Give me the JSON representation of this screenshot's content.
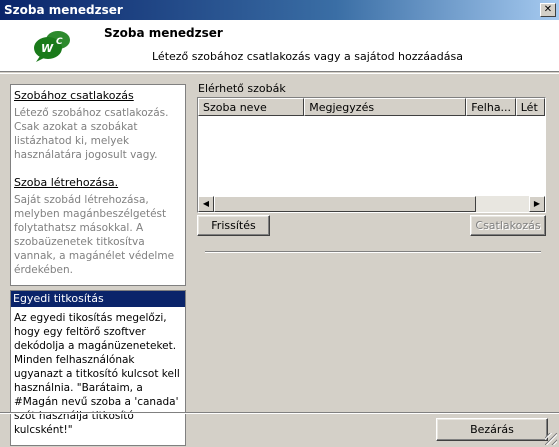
{
  "window": {
    "title": "Szoba menedzser"
  },
  "header": {
    "title": "Szoba menedzser",
    "subtitle": "Létező szobához csatlakozás vagy a sajátod hozzáadása"
  },
  "left": {
    "join_link": "Szobához csatlakozás",
    "join_text": "Létező szobához csatlakozás. Csak azokat a szobákat listázhatod ki, melyek használatára jogosult vagy.",
    "create_link": "Szoba létrehozása.",
    "create_text": "Saját szobád létrehozása, melyben magánbeszélgetést folytathatsz másokkal. A szobaüzenetek titkosítva vannak, a magánélet védelme érdekében."
  },
  "encryption": {
    "heading": "Egyedi titkosítás",
    "text": "Az egyedi tikosítás megelőzi, hogy egy feltörő szoftver dekódolja a magánüzeneteket. Minden felhasználónak ugyanazt a titkosító kulcsot kell használnia. \"Barátaim, a #Magán nevű szoba a 'canada' szót használja titkosító kulcsként!\""
  },
  "rooms": {
    "label": "Elérhető szobák",
    "columns": [
      "Szoba neve",
      "Megjegyzés",
      "Felha...",
      "Lét"
    ],
    "rows": []
  },
  "buttons": {
    "refresh": "Frissítés",
    "join": "Csatlakozás",
    "close": "Bezárás"
  },
  "icons": {
    "logo": "wc-chat-logo-icon",
    "close": "close-icon"
  },
  "colors": {
    "title_bar": "#0a246a",
    "selection": "#0a246a",
    "logo_green": "#1a7a1a"
  }
}
